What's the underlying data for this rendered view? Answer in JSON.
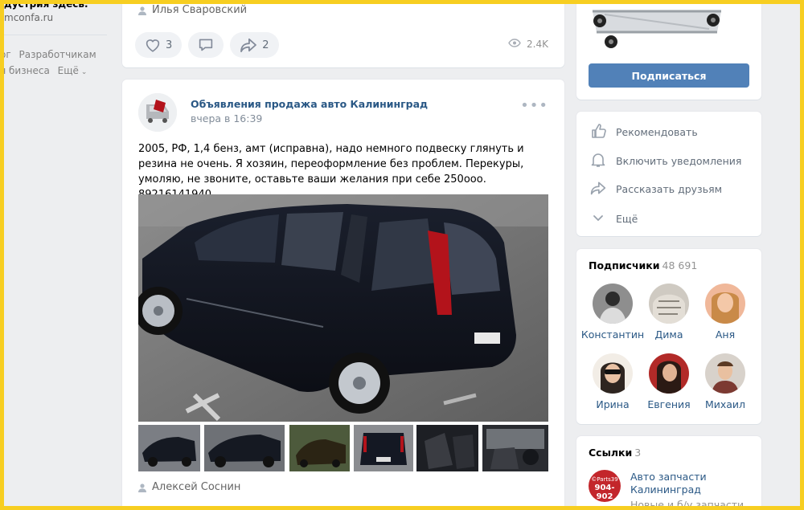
{
  "left_sidebar": {
    "ad_title": "дустрия здесь.",
    "ad_site": "mconfa.ru",
    "links_row1": [
      "ог",
      "Разработчикам"
    ],
    "links_row2": [
      "я бизнеса",
      "Ещё"
    ]
  },
  "prev_post": {
    "author": "Илья Сваровский",
    "likes": "3",
    "shares": "2",
    "views": "2.4K"
  },
  "post": {
    "group_name": "Объявления продажа авто Калининград",
    "time": "вчера в 16:39",
    "text": "2005, РФ, 1,4 бенз, амт (исправна), надо немного подвеску глянуть и резина не очень. Я хозяин, переоформление без проблем. Перекуры, умоляю, не звоните, оставьте ваши желания при себе 250ооо. 89216141940",
    "author": "Алексей Соснин",
    "thumbnail_count": 6
  },
  "right": {
    "subscribe_label": "Подписаться",
    "menu": [
      {
        "label": "Рекомендовать",
        "icon": "thumbs-up-icon"
      },
      {
        "label": "Включить уведомления",
        "icon": "bell-icon"
      },
      {
        "label": "Рассказать друзьям",
        "icon": "share-arrow-icon"
      },
      {
        "label": "Ещё",
        "icon": "chevron-down-icon"
      }
    ],
    "subscribers": {
      "title": "Подписчики",
      "count": "48 691",
      "people": [
        {
          "name": "Константин"
        },
        {
          "name": "Дима"
        },
        {
          "name": "Аня"
        },
        {
          "name": "Ирина"
        },
        {
          "name": "Евгения"
        },
        {
          "name": "Михаил"
        }
      ]
    },
    "links": {
      "title": "Ссылки",
      "count": "3",
      "badge_top": "©Parts39",
      "badge_phone": "904-902",
      "item_title": "Авто запчасти Калининград",
      "item_desc": "Новые и б/у запчасти"
    }
  },
  "colors": {
    "accent": "#5181b8",
    "link": "#2a5885",
    "frame": "#f7ce21",
    "background": "#edeef0"
  }
}
